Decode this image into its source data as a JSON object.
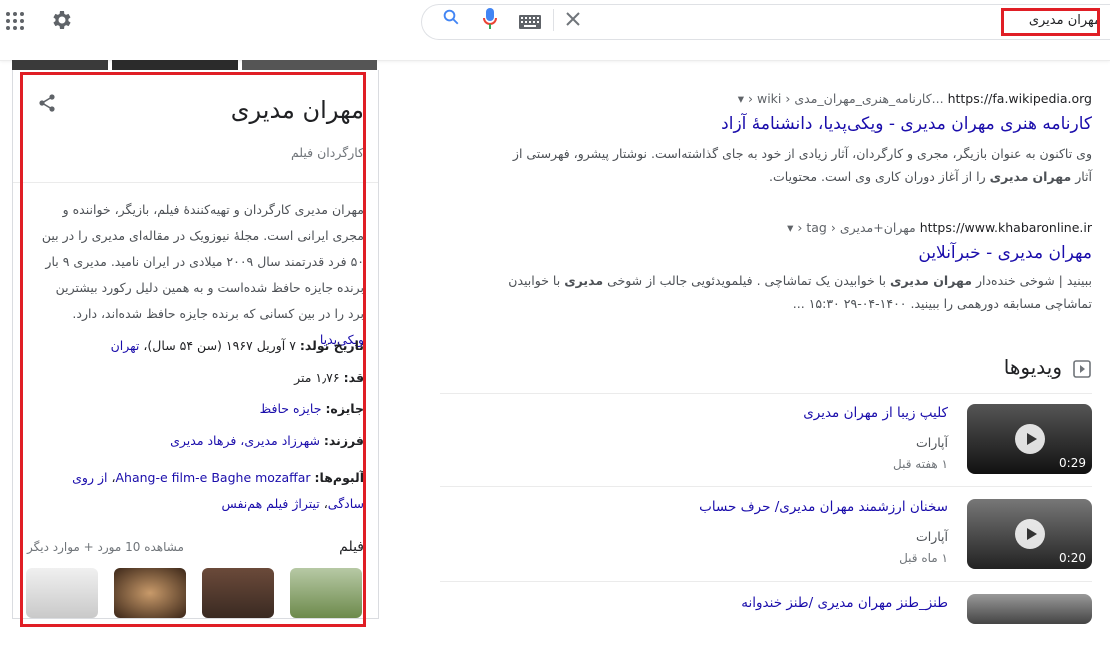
{
  "search": {
    "query": "مهران مدیری"
  },
  "knowledge_panel": {
    "title": "مهران مدیری",
    "subtitle": "کارگردان فیلم",
    "description": "مهران مدیری کارگردان و تهیه‌کنندهٔ فیلم، بازیگر، خواننده و مجری ایرانی است. مجلهٔ نیوزویک در مقاله‌ای مدیری را در بین ۵۰ فرد قدرتمند سال ۲۰۰۹ میلادی در ایران نامید. مدیری ۹ بار برنده جایزه حافظ شده‌است و به همین دلیل رکورد بیشترین برد را در بین کسانی که برنده جایزه حافظ شده‌اند، دارد.",
    "description_link": "ویکی‌پدیا",
    "facts": [
      {
        "label": "تاریخ تولد:",
        "value": "۷ آوریل ۱۹۶۷ (سن ۵۴ سال)،",
        "link": "تهران"
      },
      {
        "label": "قد:",
        "value": "۱٫۷۶ متر",
        "link": ""
      },
      {
        "label": "جایزه:",
        "value": "",
        "link": "جایزه حافظ"
      },
      {
        "label": "فرزند:",
        "value": "",
        "link": "شهرزاد مدیری، فرهاد مدیری"
      }
    ],
    "albums_label": "آلبوم‌ها:",
    "albums_links": [
      "Ahang-e film-e Baghe mozaffar",
      "از روی سادگی",
      "تیتراژ فیلم هم‌نفس"
    ],
    "films_heading": "فیلم",
    "films_more": "مشاهده 10 مورد + موارد دیگر"
  },
  "results": [
    {
      "cite_domain": "https://fa.wikipedia.org",
      "cite_path": "› wiki › کارنامه_هنری_مهران_مدی...",
      "title": "کارنامه هنری مهران مدیری - ویکی‌پدیا، دانشنامهٔ آزاد",
      "snippet_1": "وی تاکنون به عنوان بازیگر، مجری و کارگردان، آثار زیادی از خود به جای گذاشته‌است. نوشتار پیشرو، فهرستی از آثار",
      "snippet_bold_1": "مهران",
      "snippet_bold_2": "مدیری",
      "snippet_2": "را از آغاز دوران کاری وی است. محتویات."
    },
    {
      "cite_domain": "https://www.khabaronline.ir",
      "cite_path": "› tag › مهران+مدیری",
      "title": "مهران مدیری - خبرآنلاین",
      "snippet_a": "ببینید | شوخی خنده‌دار",
      "snippet_bold_a": "مهران مدیری",
      "snippet_b": "با خوابیدن یک تماشاچی . فیلمویدئویی جالب از شوخی",
      "snippet_bold_b": "مدیری",
      "snippet_c": "با خوابیدن تماشاچی",
      "snippet_d": "مسابقه دورهمی را ببینید. ۱۴۰۰-۰۴-۲۹ ۱۵:۳۰ ..."
    }
  ],
  "videos": {
    "heading": "ویدیوها",
    "items": [
      {
        "title": "کلیپ زیبا از مهران مدیری",
        "source": "آپارات",
        "date": "۱ هفته قبل",
        "duration": "0:29"
      },
      {
        "title": "سخنان ارزشمند مهران مدیری/ حرف حساب",
        "source": "آپارات",
        "date": "۱ ماه قبل",
        "duration": "0:20"
      },
      {
        "title": "طنز_طنز مهران مدیری /طنز خندوانه",
        "source": "",
        "date": "",
        "duration": ""
      }
    ]
  },
  "colors": {
    "link": "#1a0dab",
    "highlight": "#e01e25",
    "text": "#202124",
    "muted": "#70757a"
  }
}
